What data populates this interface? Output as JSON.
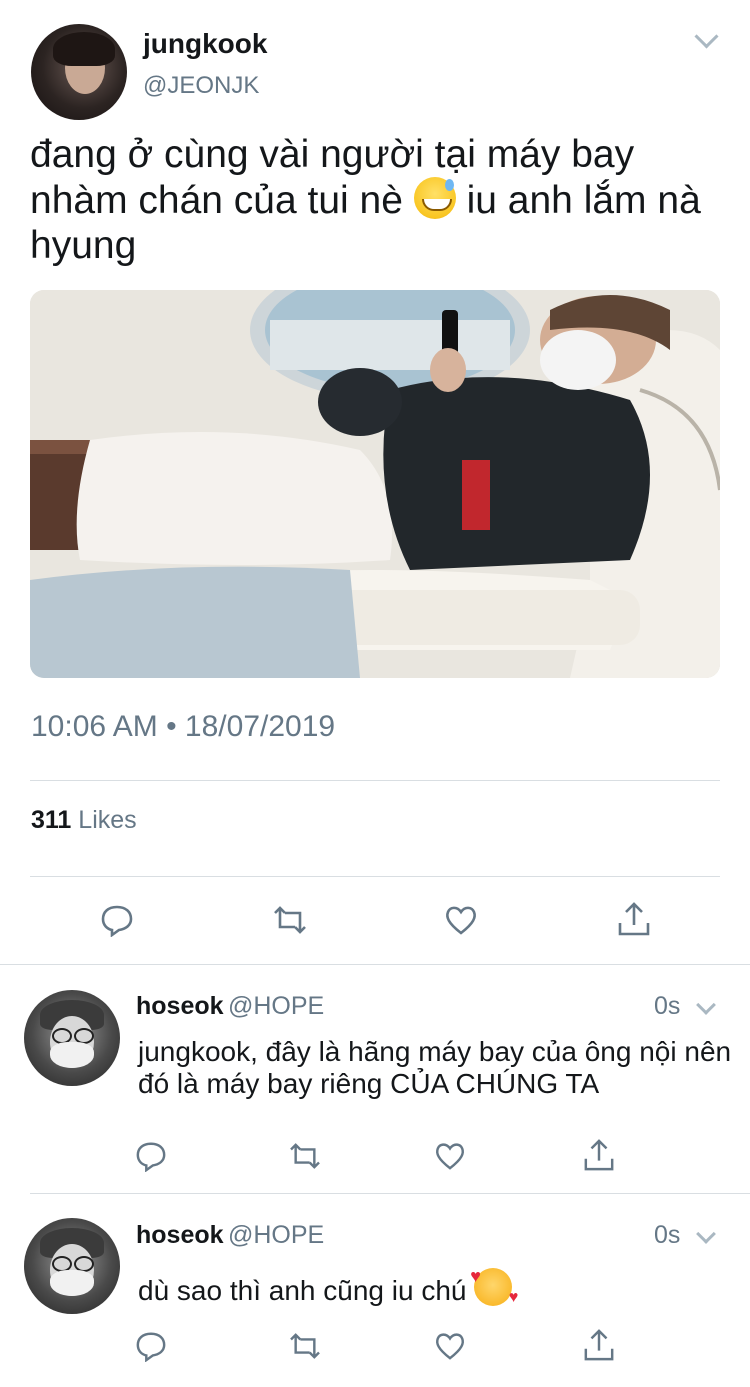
{
  "tweet": {
    "author_name": "jungkook",
    "author_handle": "@JEONJK",
    "text": "đang ở cùng vài người tại máy bay nhàm chán của tui nè",
    "text_after_emoji": " iu anh lắm nà hyung",
    "emoji": "grinning-sweat-emoji",
    "timestamp": "10:06 AM • 18/07/2019",
    "likes_count": "311",
    "likes_label": "Likes"
  },
  "replies": [
    {
      "author_name": "hoseok",
      "author_handle": "@HOPE",
      "time": "0s",
      "text": "jungkook, đây là hãng máy bay của ông nội nên đó là máy bay riêng CỦA CHÚNG TA"
    },
    {
      "author_name": "hoseok",
      "author_handle": "@HOPE",
      "time": "0s",
      "text": "dù sao thì anh cũng iu chú",
      "emoji": "smiling-face-with-hearts-emoji"
    }
  ],
  "icons": [
    "reply-icon",
    "retweet-icon",
    "like-icon",
    "share-icon",
    "chevron-down-icon"
  ],
  "colors": {
    "text": "#14171a",
    "secondary": "#657786",
    "divider": "#d9dee2"
  }
}
